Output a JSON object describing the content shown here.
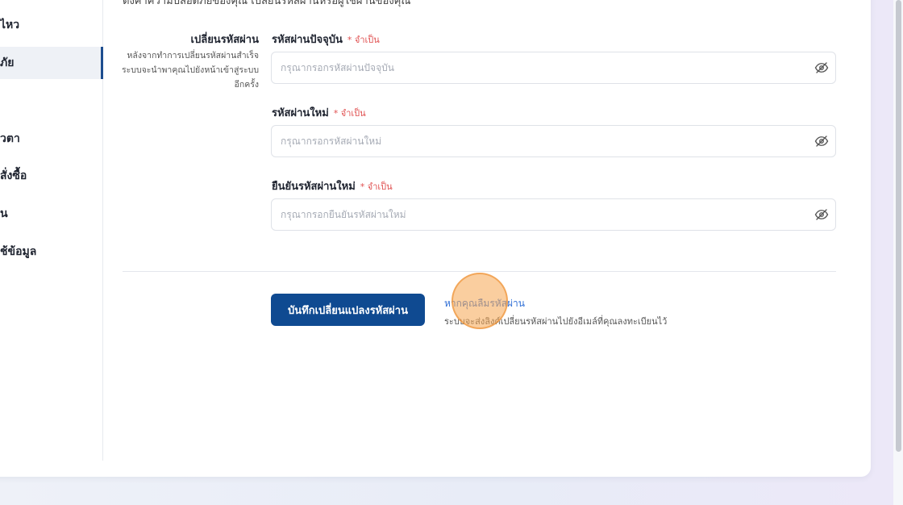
{
  "sidebar": {
    "items": [
      {
        "label": "ไหว",
        "active": false
      },
      {
        "label": "ภัย",
        "active": true
      },
      {
        "label": "วตา",
        "active": false
      },
      {
        "label": "สั่งซื้อ",
        "active": false
      },
      {
        "label": "น",
        "active": false
      },
      {
        "label": "ช้ข้อมูล",
        "active": false
      }
    ]
  },
  "header": {
    "description": "ตั้งค่าความปลอดภัยของคุณ เปลี่ยนรหัสผ่านหรือผู้ใช้ผ่านของคุณ"
  },
  "section": {
    "title": "เปลี่ยนรหัสผ่าน",
    "description": "หลังจากทำการเปลี่ยนรหัสผ่านสำเร็จ ระบบจะนำพาคุณไปยังหน้าเข้าสู่ระบบอีกครั้ง"
  },
  "fields": [
    {
      "label": "รหัสผ่านปัจจุบัน",
      "required_text": "* จำเป็น",
      "placeholder": "กรุณากรอกรหัสผ่านปัจจุบัน",
      "value": ""
    },
    {
      "label": "รหัสผ่านใหม่",
      "required_text": "* จำเป็น",
      "placeholder": "กรุณากรอกรหัสผ่านใหม่",
      "value": ""
    },
    {
      "label": "ยืนยันรหัสผ่านใหม่",
      "required_text": "* จำเป็น",
      "placeholder": "กรุณากรอกยืนยันรหัสผ่านใหม่",
      "value": ""
    }
  ],
  "icons": {
    "visibility_toggle": "eye-off-icon"
  },
  "actions": {
    "save_label": "บันทึกเปลี่ยนแปลงรหัสผ่าน",
    "forgot_link": "หากคุณลืมรหัสผ่าน",
    "forgot_description": "ระบบจะส่งลิงค์เปลี่ยนรหัสผ่านไปยังอีเมล์ที่คุณลงทะเบียนไว้"
  },
  "colors": {
    "primary": "#0f4a91",
    "link": "#2f6fd6",
    "required": "#e05050",
    "cursor_highlight": "#f5a650"
  }
}
